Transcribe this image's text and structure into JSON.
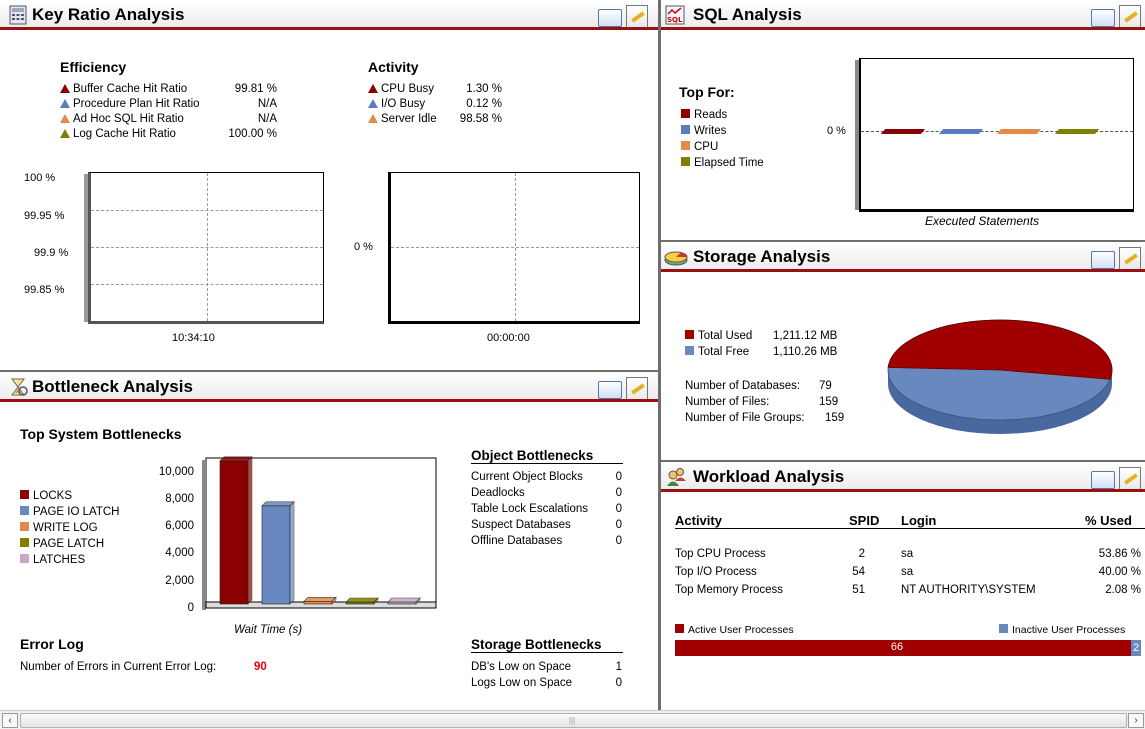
{
  "key_ratio": {
    "title": "Key Ratio Analysis",
    "efficiency_title": "Efficiency",
    "efficiency": [
      {
        "label": "Buffer Cache Hit Ratio",
        "value": "99.81 %",
        "color": "#8b0000"
      },
      {
        "label": "Procedure Plan Hit Ratio",
        "value": "N/A",
        "color": "#5b7dbf"
      },
      {
        "label": "Ad Hoc SQL Hit Ratio",
        "value": "N/A",
        "color": "#e08b4a"
      },
      {
        "label": "Log Cache Hit Ratio",
        "value": "100.00 %",
        "color": "#808000"
      }
    ],
    "activity_title": "Activity",
    "activity": [
      {
        "label": "CPU Busy",
        "value": "1.30 %",
        "color": "#8b0000"
      },
      {
        "label": "I/O Busy",
        "value": "0.12 %",
        "color": "#5b7dbf"
      },
      {
        "label": "Server Idle",
        "value": "98.58 %",
        "color": "#e08b4a"
      }
    ],
    "chart1_ticks": [
      "100 %",
      "99.95 %",
      "99.9 %",
      "99.85 %"
    ],
    "chart1_xlabel": "10:34:10",
    "chart2_tick": "0 %",
    "chart2_xlabel": "00:00:00"
  },
  "sql": {
    "title": "SQL Analysis",
    "top_for": "Top For:",
    "legend": [
      {
        "label": "Reads",
        "color": "#8b0000"
      },
      {
        "label": "Writes",
        "color": "#5b7dbf"
      },
      {
        "label": "CPU",
        "color": "#e08b4a"
      },
      {
        "label": "Elapsed Time",
        "color": "#808000"
      }
    ],
    "tick": "0 %",
    "xlabel": "Executed Statements"
  },
  "storage": {
    "title": "Storage Analysis",
    "legend": [
      {
        "label": "Total Used",
        "value": "1,211.12 MB",
        "color": "#a00000"
      },
      {
        "label": "Total Free",
        "value": "1,110.26 MB",
        "color": "#6a88c0"
      }
    ],
    "stats": [
      {
        "label": "Number of Databases:",
        "value": "79"
      },
      {
        "label": "Number of Files:",
        "value": "159"
      },
      {
        "label": "Number of File Groups:",
        "value": "159"
      }
    ]
  },
  "bottleneck": {
    "title": "Bottleneck Analysis",
    "system_title": "Top System Bottlenecks",
    "legend": [
      {
        "label": "LOCKS",
        "color": "#8b0000"
      },
      {
        "label": "PAGE IO LATCH",
        "color": "#6a88c0"
      },
      {
        "label": "WRITE LOG",
        "color": "#e08b4a"
      },
      {
        "label": "PAGE LATCH",
        "color": "#808000"
      },
      {
        "label": "LATCHES",
        "color": "#c8a8c8"
      }
    ],
    "ticks": [
      "10,000",
      "8,000",
      "6,000",
      "4,000",
      "2,000",
      "0"
    ],
    "xlabel": "Wait Time (s)",
    "object_title": "Object Bottlenecks",
    "object_items": [
      {
        "label": "Current Object Blocks",
        "value": "0"
      },
      {
        "label": "Deadlocks",
        "value": "0"
      },
      {
        "label": "Table Lock Escalations",
        "value": "0"
      },
      {
        "label": "Suspect Databases",
        "value": "0"
      },
      {
        "label": "Offline Databases",
        "value": "0"
      }
    ],
    "error_title": "Error Log",
    "error_label": "Number of Errors in Current Error Log:",
    "error_value": "90",
    "storage_title": "Storage Bottlenecks",
    "storage_items": [
      {
        "label": "DB's Low on Space",
        "value": "1"
      },
      {
        "label": "Logs Low on Space",
        "value": "0"
      }
    ]
  },
  "workload": {
    "title": "Workload Analysis",
    "headers": {
      "activity": "Activity",
      "spid": "SPID",
      "login": "Login",
      "used": "% Used"
    },
    "rows": [
      {
        "activity": "Top CPU Process",
        "spid": "2",
        "login": "sa",
        "used": "53.86 %"
      },
      {
        "activity": "Top I/O Process",
        "spid": "54",
        "login": "sa",
        "used": "40.00 %"
      },
      {
        "activity": "Top Memory Process",
        "spid": "51",
        "login": "NT AUTHORITY\\SYSTEM",
        "used": "2.08 %"
      }
    ],
    "active_label": "Active User Processes",
    "inactive_label": "Inactive User Processes",
    "active_value": "66",
    "inactive_value": "2",
    "active_color": "#a00000",
    "inactive_color": "#6a88c0"
  },
  "chart_data": [
    {
      "type": "bar",
      "title": "",
      "categories": [
        "LOCKS",
        "PAGE IO LATCH",
        "WRITE LOG",
        "PAGE LATCH",
        "LATCHES"
      ],
      "values": [
        10500,
        7200,
        200,
        50,
        30
      ],
      "xlabel": "Wait Time (s)",
      "ylim": [
        0,
        10000
      ]
    },
    {
      "type": "pie",
      "categories": [
        "Total Used",
        "Total Free"
      ],
      "values": [
        1211.12,
        1110.26
      ]
    }
  ]
}
